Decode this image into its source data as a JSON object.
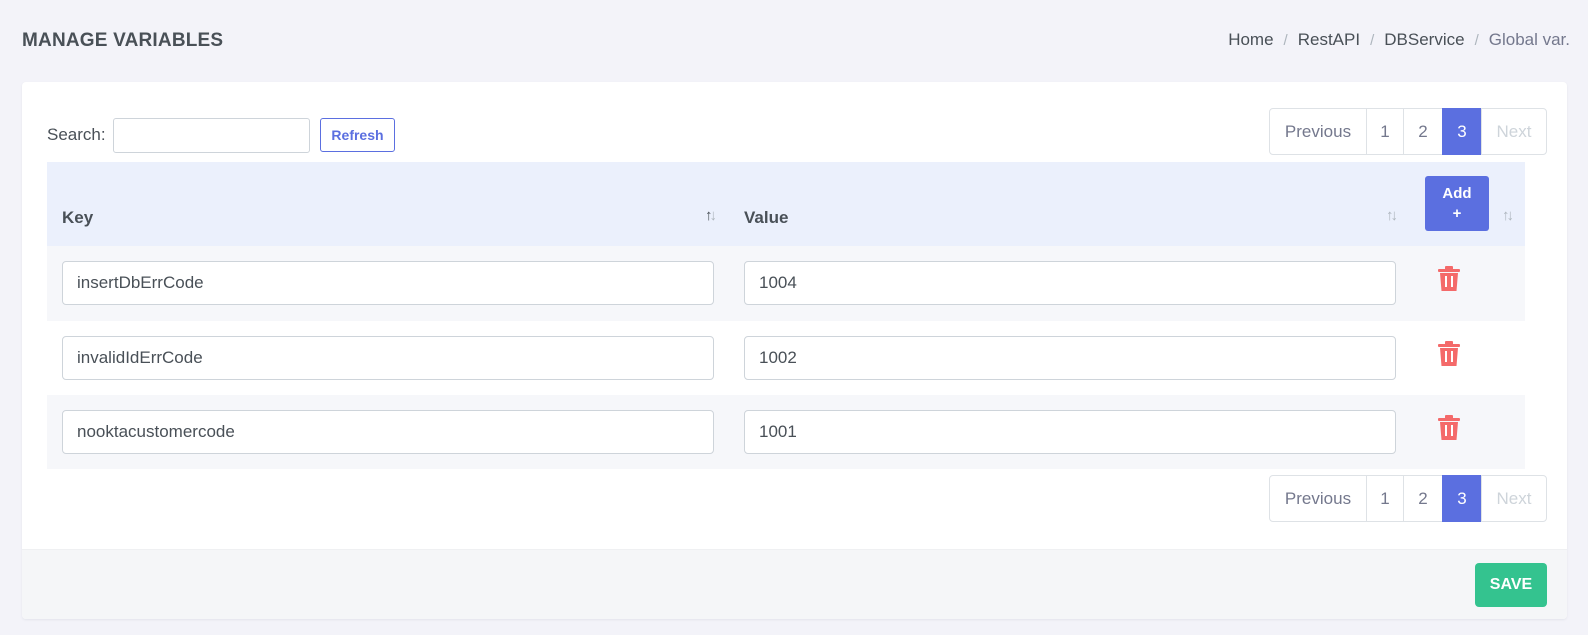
{
  "header": {
    "title": "MANAGE VARIABLES",
    "breadcrumb": [
      "Home",
      "RestAPI",
      "DBService",
      "Global var."
    ],
    "breadcrumb_separator": "/"
  },
  "toolbar": {
    "search_label": "Search:",
    "search_value": "",
    "refresh_label": "Refresh"
  },
  "pagination": {
    "previous_label": "Previous",
    "next_label": "Next",
    "pages": [
      "1",
      "2",
      "3"
    ],
    "current_page": "3"
  },
  "table": {
    "columns": {
      "key": "Key",
      "value": "Value"
    },
    "add_label_line1": "Add",
    "add_label_line2": "+",
    "rows": [
      {
        "key": "insertDbErrCode",
        "value": "1004"
      },
      {
        "key": "invalidIdErrCode",
        "value": "1002"
      },
      {
        "key": "nooktacustomercode",
        "value": "1001"
      }
    ]
  },
  "footer": {
    "save_label": "SAVE"
  },
  "colors": {
    "primary": "#5b6fe0",
    "success": "#34c38f",
    "danger": "#f46a6a",
    "table_header_bg": "#ebf0fc",
    "page_bg": "#f3f3f9"
  },
  "icons": {
    "delete": "trash-icon",
    "sort": "sort-arrows-icon"
  }
}
